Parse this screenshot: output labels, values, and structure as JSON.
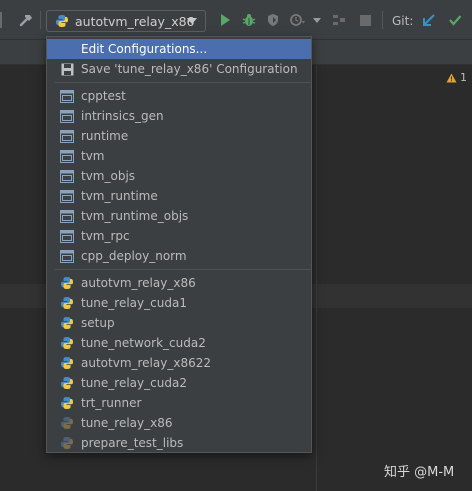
{
  "toolbar": {
    "run_config": "autotvm_relay_x86",
    "git_label": "Git:"
  },
  "editor": {
    "warning_count": "1",
    "watermark": "知乎 @M-M"
  },
  "menu": {
    "actions": [
      {
        "label": "Edit Configurations...",
        "icon": "",
        "selected": true
      },
      {
        "label": "Save 'tune_relay_x86' Configuration",
        "icon": "save-icon",
        "selected": false
      }
    ],
    "cmake_targets": [
      {
        "label": "cpptest"
      },
      {
        "label": "intrinsics_gen"
      },
      {
        "label": "runtime"
      },
      {
        "label": "tvm"
      },
      {
        "label": "tvm_objs"
      },
      {
        "label": "tvm_runtime"
      },
      {
        "label": "tvm_runtime_objs"
      },
      {
        "label": "tvm_rpc"
      },
      {
        "label": "cpp_deploy_norm"
      }
    ],
    "python_configs": [
      {
        "label": "autotvm_relay_x86",
        "dim": false
      },
      {
        "label": "tune_relay_cuda1",
        "dim": false
      },
      {
        "label": "setup",
        "dim": false
      },
      {
        "label": "tune_network_cuda2",
        "dim": false
      },
      {
        "label": "autotvm_relay_x8622",
        "dim": false
      },
      {
        "label": "tune_relay_cuda2",
        "dim": false
      },
      {
        "label": "trt_runner",
        "dim": false
      },
      {
        "label": "tune_relay_x86",
        "dim": true
      },
      {
        "label": "prepare_test_libs",
        "dim": true
      }
    ]
  },
  "colors": {
    "selection": "#4b6eaf",
    "run_green": "#59a869",
    "git_blue": "#3592c4",
    "git_green": "#59a869"
  }
}
